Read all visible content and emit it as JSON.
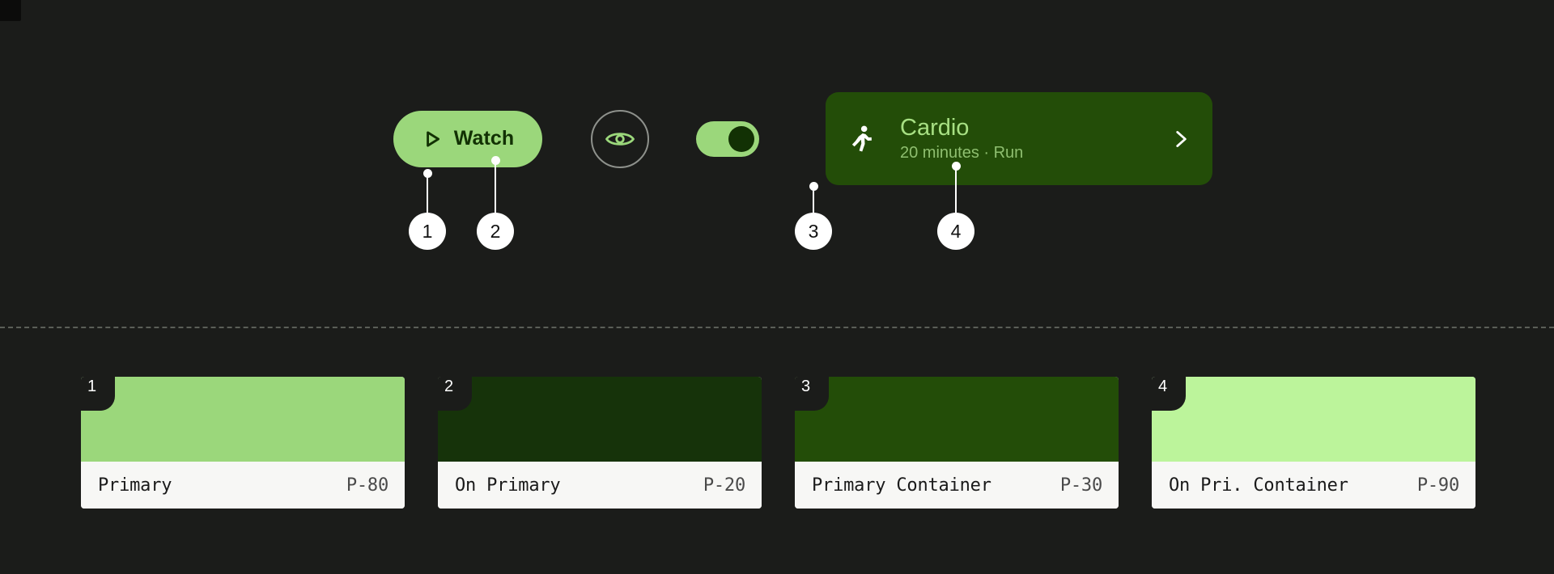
{
  "theme": {
    "background": "#1b1c1a",
    "divider_color": "#5b5e58",
    "callout_fill": "#ffffff",
    "callout_text": "#111111"
  },
  "showcase": {
    "watch_button": {
      "label": "Watch",
      "icon": "play-triangle-icon",
      "background": "#9BD77B",
      "foreground": "#123104"
    },
    "eye_button": {
      "icon": "eye-icon",
      "ring_color": "#8e918c",
      "icon_color": "#9BD77B"
    },
    "toggle": {
      "state": "on",
      "track_color": "#9BD77B",
      "thumb_color": "#123104"
    },
    "cardio_card": {
      "icon": "running-person-icon",
      "title": "Cardio",
      "subtitle": "20 minutes · Run",
      "chevron": "chevron-right-icon",
      "background": "#234D08",
      "title_color": "#A7E083",
      "subtitle_color": "#8FBF70",
      "icon_color": "#ffffff"
    }
  },
  "callouts": [
    {
      "number": "1",
      "target": "watch-button-container"
    },
    {
      "number": "2",
      "target": "watch-button-label"
    },
    {
      "number": "3",
      "target": "cardio-card-container"
    },
    {
      "number": "4",
      "target": "cardio-card-subtitle"
    }
  ],
  "swatches": [
    {
      "number": "1",
      "name": "Primary",
      "token": "P-80",
      "color": "#9BD77B"
    },
    {
      "number": "2",
      "name": "On Primary",
      "token": "P-20",
      "color": "#16330A"
    },
    {
      "number": "3",
      "name": "Primary Container",
      "token": "P-30",
      "color": "#234D08"
    },
    {
      "number": "4",
      "name": "On Pri. Container",
      "token": "P-90",
      "color": "#BCF49B"
    }
  ]
}
